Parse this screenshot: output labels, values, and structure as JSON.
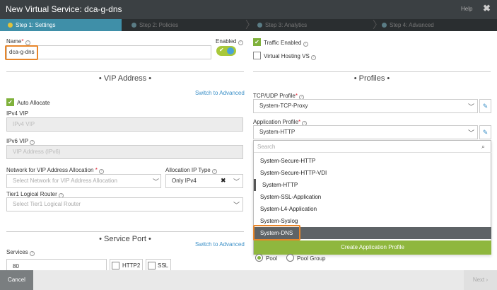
{
  "window": {
    "title": "New Virtual Service: dca-g-dns",
    "help": "Help",
    "close": "✖"
  },
  "steps": [
    {
      "label": "Step 1: Settings"
    },
    {
      "label": "Step 2: Policies"
    },
    {
      "label": "Step 3: Analytics"
    },
    {
      "label": "Step 4: Advanced"
    }
  ],
  "left": {
    "name_label": "Name",
    "name_value": "dca-g-dns",
    "enabled_label": "Enabled",
    "vip_section": "• VIP Address •",
    "switch_advanced": "Switch to Advanced",
    "auto_allocate": "Auto Allocate",
    "ipv4_label": "IPv4 VIP",
    "ipv4_placeholder": "IPv4 VIP",
    "ipv6_label": "IPv6 VIP",
    "ipv6_placeholder": "VIP Address (IPv6)",
    "network_label": "Network for VIP Address Allocation",
    "network_placeholder": "Select Network for VIP Address Allocation",
    "alloc_type_label": "Allocation IP Type",
    "alloc_type_value": "Only IPv4",
    "tier1_label": "Tier1 Logical Router",
    "tier1_placeholder": "Select Tier1 Logical Router",
    "service_section": "• Service Port •",
    "switch_advanced2": "Switch to Advanced",
    "services_label": "Services",
    "services_value": "80",
    "http2": "HTTP2",
    "ssl": "SSL"
  },
  "right": {
    "traffic_enabled": "Traffic Enabled",
    "virtual_hosting": "Virtual Hosting VS",
    "profiles_section": "• Profiles •",
    "tcp_label": "TCP/UDP Profile",
    "tcp_value": "System-TCP-Proxy",
    "app_label": "Application Profile",
    "app_value": "System-HTTP",
    "search_placeholder": "Search",
    "options": [
      "System-Secure-HTTP",
      "System-Secure-HTTP-VDI",
      "System-HTTP",
      "System-SSL-Application",
      "System-L4-Application",
      "System-Syslog",
      "System-DNS"
    ],
    "create_button": "Create Application Profile",
    "pool": "Pool",
    "pool_group": "Pool Group"
  },
  "footer": {
    "cancel": "Cancel",
    "next": "Next ›"
  },
  "colors": {
    "accent": "#7fb13b",
    "highlight": "#e8862a",
    "step_active": "#3f8fa8"
  }
}
